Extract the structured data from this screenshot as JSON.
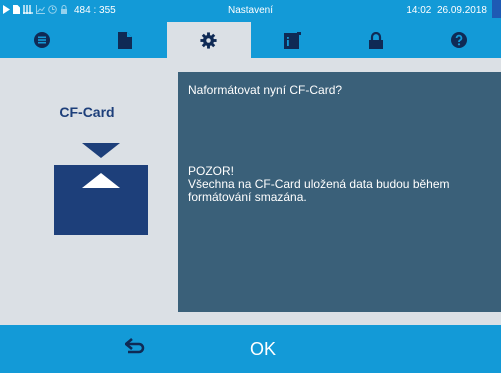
{
  "status_bar": {
    "coordinates": "484 : 355",
    "title": "Nastavení",
    "time": "14:02",
    "date": "26.09.2018",
    "icons": [
      "play-icon",
      "document-icon",
      "waves-icon",
      "chart-icon",
      "clock-icon",
      "lock-icon"
    ],
    "colors": {
      "bar": "#139ad7",
      "network_indicator": "#1e5ab4"
    }
  },
  "tabs": [
    {
      "icon": "menu-list-icon",
      "active": false
    },
    {
      "icon": "document-icon",
      "active": false
    },
    {
      "icon": "gear-icon",
      "active": true
    },
    {
      "icon": "log-book-icon",
      "active": false
    },
    {
      "icon": "lock-icon",
      "active": false
    },
    {
      "icon": "help-icon",
      "active": false
    }
  ],
  "device": {
    "label": "CF-Card",
    "icon": "cf-card-eject-icon"
  },
  "message": {
    "question": "Naformátovat nyní CF-Card?",
    "warning_title": "POZOR!",
    "warning_text": "Všechna na CF-Card uložená data budou během formátování smazána."
  },
  "bottom_bar": {
    "back_icon": "back-arrow-icon",
    "ok_label": "OK"
  },
  "colors": {
    "accent": "#139ad7",
    "background": "#dbe0e5",
    "panel": "#3a6079",
    "navy": "#1d3f7a"
  }
}
